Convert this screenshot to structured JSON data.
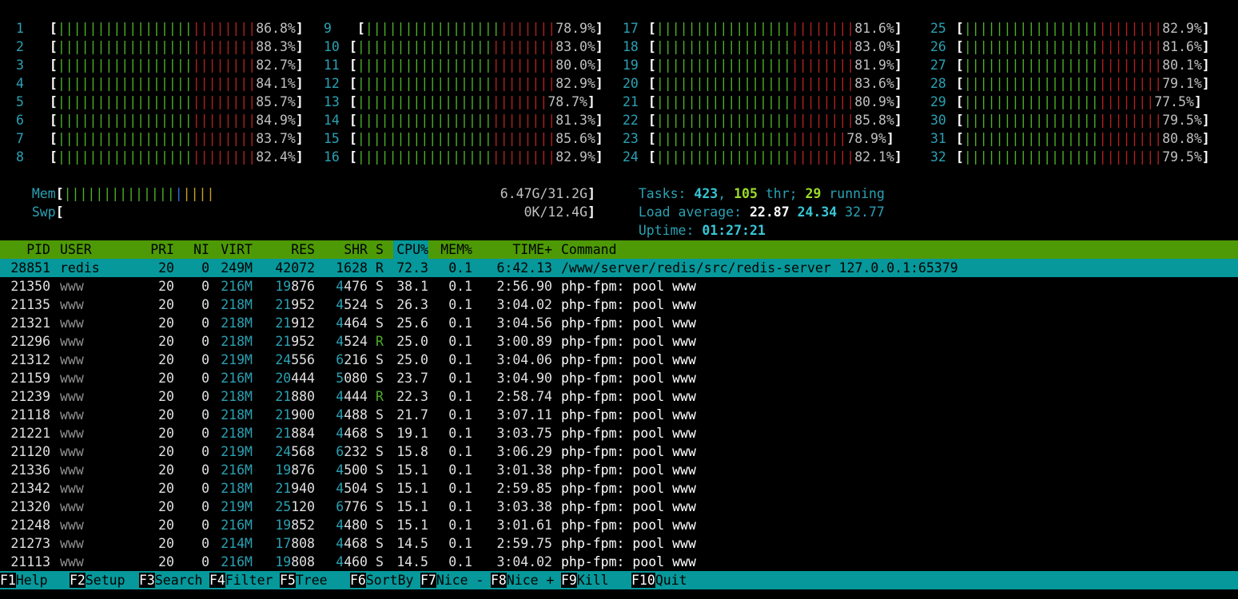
{
  "cpus": [
    {
      "id": "1",
      "pct": "86.8%",
      "value": 86.8
    },
    {
      "id": "2",
      "pct": "88.3%",
      "value": 88.3
    },
    {
      "id": "3",
      "pct": "82.7%",
      "value": 82.7
    },
    {
      "id": "4",
      "pct": "84.1%",
      "value": 84.1
    },
    {
      "id": "5",
      "pct": "85.7%",
      "value": 85.7
    },
    {
      "id": "6",
      "pct": "84.9%",
      "value": 84.9
    },
    {
      "id": "7",
      "pct": "83.7%",
      "value": 83.7
    },
    {
      "id": "8",
      "pct": "82.4%",
      "value": 82.4
    },
    {
      "id": "9",
      "pct": "78.9%",
      "value": 78.9
    },
    {
      "id": "10",
      "pct": "83.0%",
      "value": 83.0
    },
    {
      "id": "11",
      "pct": "80.0%",
      "value": 80.0
    },
    {
      "id": "12",
      "pct": "82.9%",
      "value": 82.9
    },
    {
      "id": "13",
      "pct": "78.7%",
      "value": 78.7
    },
    {
      "id": "14",
      "pct": "81.3%",
      "value": 81.3
    },
    {
      "id": "15",
      "pct": "85.6%",
      "value": 85.6
    },
    {
      "id": "16",
      "pct": "82.9%",
      "value": 82.9
    },
    {
      "id": "17",
      "pct": "81.6%",
      "value": 81.6
    },
    {
      "id": "18",
      "pct": "83.0%",
      "value": 83.0
    },
    {
      "id": "19",
      "pct": "81.9%",
      "value": 81.9
    },
    {
      "id": "20",
      "pct": "83.6%",
      "value": 83.6
    },
    {
      "id": "21",
      "pct": "80.9%",
      "value": 80.9
    },
    {
      "id": "22",
      "pct": "85.8%",
      "value": 85.8
    },
    {
      "id": "23",
      "pct": "78.9%",
      "value": 78.9
    },
    {
      "id": "24",
      "pct": "82.1%",
      "value": 82.1
    },
    {
      "id": "25",
      "pct": "82.9%",
      "value": 82.9
    },
    {
      "id": "26",
      "pct": "81.6%",
      "value": 81.6
    },
    {
      "id": "27",
      "pct": "80.1%",
      "value": 80.1
    },
    {
      "id": "28",
      "pct": "79.1%",
      "value": 79.1
    },
    {
      "id": "29",
      "pct": "77.5%",
      "value": 77.5
    },
    {
      "id": "30",
      "pct": "79.5%",
      "value": 79.5
    },
    {
      "id": "31",
      "pct": "80.8%",
      "value": 80.8
    },
    {
      "id": "32",
      "pct": "79.5%",
      "value": 79.5
    }
  ],
  "mem": {
    "label": "Mem",
    "value": "6.47G/31.2G"
  },
  "swp": {
    "label": "Swp",
    "value": "0K/12.4G"
  },
  "tasks": {
    "label": "Tasks:",
    "count": "423",
    "thr": "105",
    "thr_label": "thr;",
    "running": "29",
    "running_label": "running"
  },
  "load": {
    "label": "Load average:",
    "l1": "22.87",
    "l5": "24.34",
    "l15": "32.77"
  },
  "uptime": {
    "label": "Uptime:",
    "value": "01:27:21"
  },
  "columns": [
    "PID",
    "USER",
    "PRI",
    "NI",
    "VIRT",
    "RES",
    "SHR",
    "S",
    "CPU%",
    "MEM%",
    "TIME+",
    "Command"
  ],
  "selected": {
    "pid": "28851",
    "user": "redis",
    "pri": "20",
    "ni": "0",
    "virt": "249M",
    "res": "42072",
    "shr": "1628",
    "s": "R",
    "cpu": "72.3",
    "mem": "0.1",
    "time": "6:42.13",
    "cmd": "/www/server/redis/src/redis-server 127.0.0.1:65379"
  },
  "processes": [
    {
      "pid": "21350",
      "user": "www",
      "pri": "20",
      "ni": "0",
      "virt": "216M",
      "res": "19876",
      "shr": "4476",
      "s": "S",
      "cpu": "38.1",
      "mem": "0.1",
      "time": "2:56.90",
      "cmd": "php-fpm: pool www"
    },
    {
      "pid": "21135",
      "user": "www",
      "pri": "20",
      "ni": "0",
      "virt": "218M",
      "res": "21952",
      "shr": "4524",
      "s": "S",
      "cpu": "26.3",
      "mem": "0.1",
      "time": "3:04.02",
      "cmd": "php-fpm: pool www"
    },
    {
      "pid": "21321",
      "user": "www",
      "pri": "20",
      "ni": "0",
      "virt": "218M",
      "res": "21912",
      "shr": "4464",
      "s": "S",
      "cpu": "25.6",
      "mem": "0.1",
      "time": "3:04.56",
      "cmd": "php-fpm: pool www"
    },
    {
      "pid": "21296",
      "user": "www",
      "pri": "20",
      "ni": "0",
      "virt": "218M",
      "res": "21952",
      "shr": "4524",
      "s": "R",
      "cpu": "25.0",
      "mem": "0.1",
      "time": "3:00.89",
      "cmd": "php-fpm: pool www"
    },
    {
      "pid": "21312",
      "user": "www",
      "pri": "20",
      "ni": "0",
      "virt": "219M",
      "res": "24556",
      "shr": "6216",
      "s": "S",
      "cpu": "25.0",
      "mem": "0.1",
      "time": "3:04.06",
      "cmd": "php-fpm: pool www"
    },
    {
      "pid": "21159",
      "user": "www",
      "pri": "20",
      "ni": "0",
      "virt": "216M",
      "res": "20444",
      "shr": "5080",
      "s": "S",
      "cpu": "23.7",
      "mem": "0.1",
      "time": "3:04.90",
      "cmd": "php-fpm: pool www"
    },
    {
      "pid": "21239",
      "user": "www",
      "pri": "20",
      "ni": "0",
      "virt": "218M",
      "res": "21880",
      "shr": "4444",
      "s": "R",
      "cpu": "22.3",
      "mem": "0.1",
      "time": "2:58.74",
      "cmd": "php-fpm: pool www"
    },
    {
      "pid": "21118",
      "user": "www",
      "pri": "20",
      "ni": "0",
      "virt": "218M",
      "res": "21900",
      "shr": "4488",
      "s": "S",
      "cpu": "21.7",
      "mem": "0.1",
      "time": "3:07.11",
      "cmd": "php-fpm: pool www"
    },
    {
      "pid": "21221",
      "user": "www",
      "pri": "20",
      "ni": "0",
      "virt": "218M",
      "res": "21884",
      "shr": "4468",
      "s": "S",
      "cpu": "19.1",
      "mem": "0.1",
      "time": "3:03.75",
      "cmd": "php-fpm: pool www"
    },
    {
      "pid": "21120",
      "user": "www",
      "pri": "20",
      "ni": "0",
      "virt": "219M",
      "res": "24568",
      "shr": "6232",
      "s": "S",
      "cpu": "15.8",
      "mem": "0.1",
      "time": "3:06.29",
      "cmd": "php-fpm: pool www"
    },
    {
      "pid": "21336",
      "user": "www",
      "pri": "20",
      "ni": "0",
      "virt": "216M",
      "res": "19876",
      "shr": "4500",
      "s": "S",
      "cpu": "15.1",
      "mem": "0.1",
      "time": "3:01.38",
      "cmd": "php-fpm: pool www"
    },
    {
      "pid": "21342",
      "user": "www",
      "pri": "20",
      "ni": "0",
      "virt": "218M",
      "res": "21940",
      "shr": "4504",
      "s": "S",
      "cpu": "15.1",
      "mem": "0.1",
      "time": "2:59.85",
      "cmd": "php-fpm: pool www"
    },
    {
      "pid": "21320",
      "user": "www",
      "pri": "20",
      "ni": "0",
      "virt": "219M",
      "res": "25120",
      "shr": "6776",
      "s": "S",
      "cpu": "15.1",
      "mem": "0.1",
      "time": "3:03.38",
      "cmd": "php-fpm: pool www"
    },
    {
      "pid": "21248",
      "user": "www",
      "pri": "20",
      "ni": "0",
      "virt": "216M",
      "res": "19852",
      "shr": "4480",
      "s": "S",
      "cpu": "15.1",
      "mem": "0.1",
      "time": "3:01.61",
      "cmd": "php-fpm: pool www"
    },
    {
      "pid": "21273",
      "user": "www",
      "pri": "20",
      "ni": "0",
      "virt": "214M",
      "res": "17808",
      "shr": "4468",
      "s": "S",
      "cpu": "14.5",
      "mem": "0.1",
      "time": "2:59.75",
      "cmd": "php-fpm: pool www"
    },
    {
      "pid": "21113",
      "user": "www",
      "pri": "20",
      "ni": "0",
      "virt": "216M",
      "res": "19808",
      "shr": "4460",
      "s": "S",
      "cpu": "14.5",
      "mem": "0.1",
      "time": "3:04.02",
      "cmd": "php-fpm: pool www"
    }
  ],
  "footer": [
    {
      "key": "F1",
      "label": "Help"
    },
    {
      "key": "F2",
      "label": "Setup"
    },
    {
      "key": "F3",
      "label": "Search"
    },
    {
      "key": "F4",
      "label": "Filter"
    },
    {
      "key": "F5",
      "label": "Tree"
    },
    {
      "key": "F6",
      "label": "SortBy"
    },
    {
      "key": "F7",
      "label": "Nice -"
    },
    {
      "key": "F8",
      "label": "Nice +"
    },
    {
      "key": "F9",
      "label": "Kill"
    },
    {
      "key": "F10",
      "label": "Quit"
    }
  ],
  "colors": {
    "header_bg": "#4e9a06",
    "selected_bg": "#06989a",
    "bar_green": "#4caf28",
    "bar_red": "#b02020"
  }
}
